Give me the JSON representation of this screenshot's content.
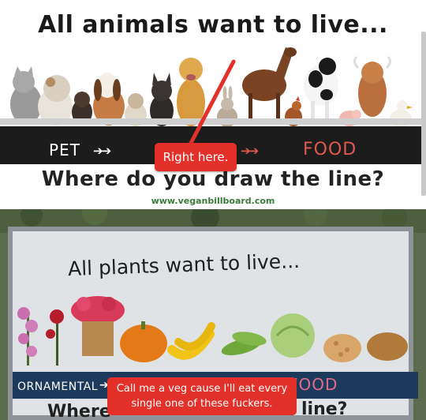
{
  "top_panel": {
    "title": "All animals want to live...",
    "pet_label": "PET",
    "food_label": "FOOD",
    "arrows": "➔➔",
    "arrows_right": "➔➔",
    "question": "Where do you draw the line?",
    "url": "www.veganbillboard.com",
    "annotation": "Right here."
  },
  "bottom_panel": {
    "title": "All plants want to live...",
    "ornamental_label": "ORNAMENTAL",
    "arrows": "➔➔➔➔➔➔➔➔",
    "food_label": "FOOD",
    "where_text": "Where",
    "line_text": "line?",
    "caption": "Call me a veg cause I'll eat every single one of these fuckers."
  },
  "colors": {
    "annotation_red": "#e3312a",
    "band_dark": "#1c1c1c",
    "food_red": "#e0584f",
    "billboard_band": "#1b3a5c"
  }
}
